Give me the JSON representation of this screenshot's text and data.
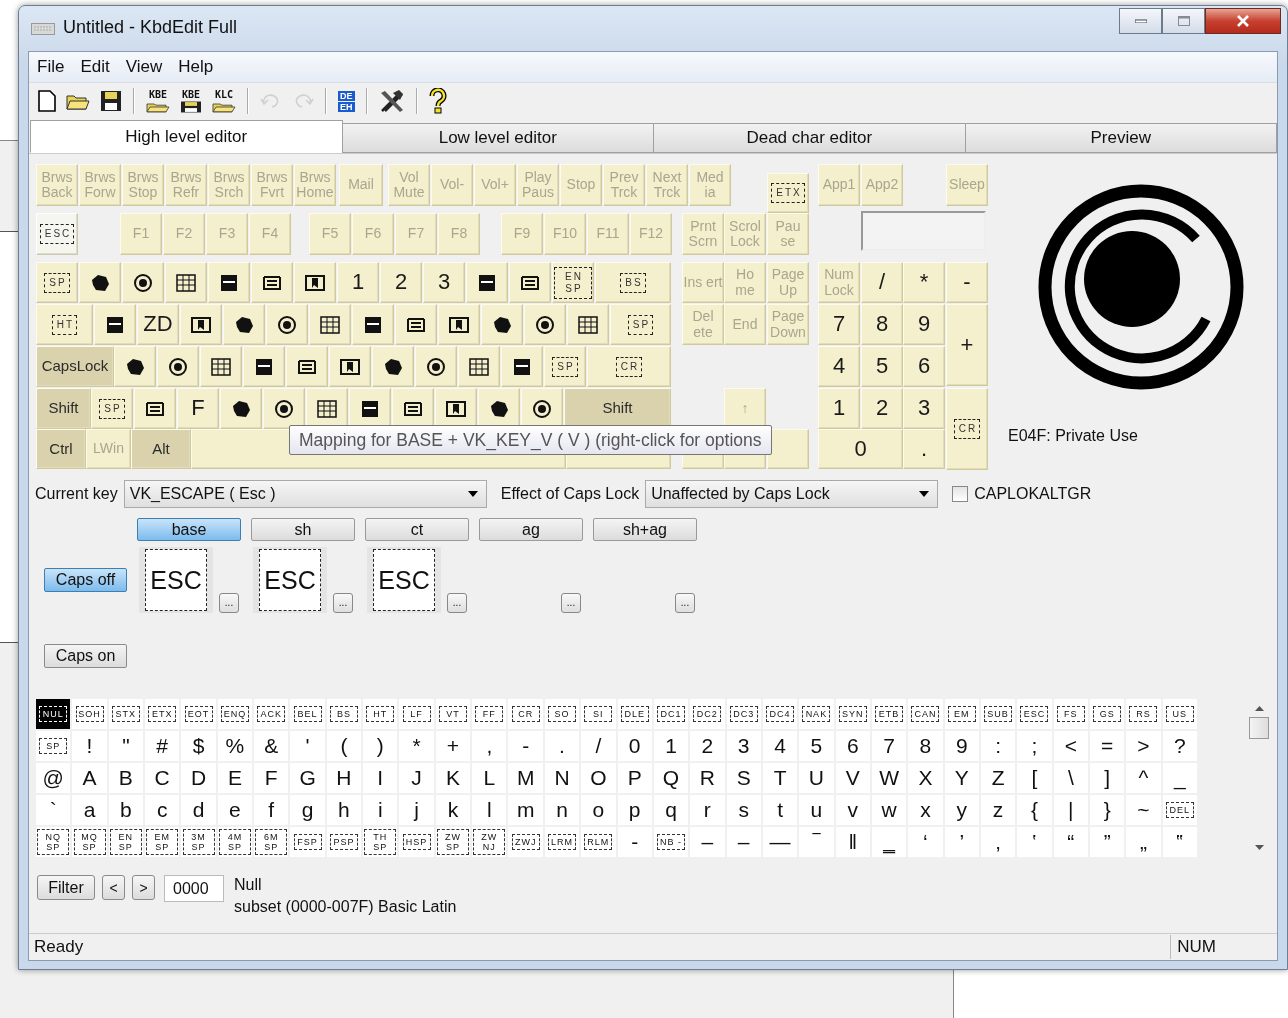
{
  "window": {
    "title": "Untitled - KbdEdit Full"
  },
  "menu": [
    "File",
    "Edit",
    "View",
    "Help"
  ],
  "toolbar": [
    {
      "kind": "new",
      "disabled": false
    },
    {
      "kind": "open",
      "disabled": false
    },
    {
      "kind": "save",
      "disabled": false
    },
    {
      "kind": "separator"
    },
    {
      "kind": "open",
      "label": "KBE",
      "disabled": false
    },
    {
      "kind": "save",
      "label": "KBE",
      "disabled": false
    },
    {
      "kind": "open",
      "label": "KLC",
      "disabled": false
    },
    {
      "kind": "separator"
    },
    {
      "kind": "undo",
      "disabled": true
    },
    {
      "kind": "redo",
      "disabled": true
    },
    {
      "kind": "separator"
    },
    {
      "kind": "table",
      "labels": [
        "DE",
        "EH"
      ],
      "disabled": false
    },
    {
      "kind": "separator"
    },
    {
      "kind": "tools",
      "disabled": false
    },
    {
      "kind": "separator"
    },
    {
      "kind": "help",
      "disabled": false
    }
  ],
  "tabs": [
    {
      "label": "High level editor",
      "selected": true
    },
    {
      "label": "Low level editor",
      "selected": false
    },
    {
      "label": "Dead char editor",
      "selected": false
    },
    {
      "label": "Preview",
      "selected": false
    }
  ],
  "keyboard": {
    "key_rows": [
      {
        "keys": [
          {
            "kind": "function",
            "label": "Brws Back",
            "selected": false
          },
          {
            "kind": "function",
            "label": "Brws Forw",
            "selected": false
          },
          {
            "kind": "function",
            "label": "Brws Stop",
            "selected": false
          },
          {
            "kind": "function",
            "label": "Brws Refr",
            "selected": false
          },
          {
            "kind": "function",
            "label": "Brws Srch",
            "selected": false
          },
          {
            "kind": "function",
            "label": "Brws Fvrt",
            "selected": false
          },
          {
            "kind": "function",
            "label": "Brws Home",
            "selected": false
          },
          {
            "kind": "function",
            "label": "Mail",
            "selected": false
          },
          {
            "kind": "function",
            "label": "Vol Mute",
            "selected": false
          },
          {
            "kind": "function",
            "label": "Vol-",
            "selected": false
          },
          {
            "kind": "function",
            "label": "Vol+",
            "selected": false
          },
          {
            "kind": "function",
            "label": "Play Paus",
            "selected": false
          },
          {
            "kind": "function",
            "label": "Stop",
            "selected": false
          },
          {
            "kind": "function",
            "label": "Prev Trck",
            "selected": false
          },
          {
            "kind": "function",
            "label": "Next Trck",
            "selected": false
          },
          {
            "kind": "function",
            "label": "Med ia",
            "selected": false
          },
          {
            "kind": "control",
            "label": "ETX",
            "selected": false
          },
          {
            "kind": "function",
            "label": "App1",
            "selected": false
          },
          {
            "kind": "function",
            "label": "App2",
            "selected": false
          },
          {
            "kind": "function",
            "label": "Sleep",
            "selected": false
          }
        ]
      },
      {
        "keys": [
          {
            "kind": "control",
            "label": "ESC",
            "selected": true
          },
          {
            "kind": "function",
            "label": "F1",
            "selected": false
          },
          {
            "kind": "function",
            "label": "F2",
            "selected": false
          },
          {
            "kind": "function",
            "label": "F3",
            "selected": false
          },
          {
            "kind": "function",
            "label": "F4",
            "selected": false
          },
          {
            "kind": "function",
            "label": "F5",
            "selected": false
          },
          {
            "kind": "function",
            "label": "F6",
            "selected": false
          },
          {
            "kind": "function",
            "label": "F7",
            "selected": false
          },
          {
            "kind": "function",
            "label": "F8",
            "selected": false
          },
          {
            "kind": "function",
            "label": "F9",
            "selected": false
          },
          {
            "kind": "function",
            "label": "F10",
            "selected": false
          },
          {
            "kind": "function",
            "label": "F11",
            "selected": false
          },
          {
            "kind": "function",
            "label": "F12",
            "selected": false
          },
          {
            "kind": "function",
            "label": "Prnt Scrn",
            "selected": false
          },
          {
            "kind": "function",
            "label": "Scrol Lock",
            "selected": false
          },
          {
            "kind": "function",
            "label": "Pau se",
            "selected": false
          }
        ]
      },
      {
        "keys": [
          {
            "kind": "control",
            "label": "SP",
            "selected": false
          },
          {
            "kind": "glyph",
            "selected": false
          },
          {
            "kind": "glyph",
            "selected": false
          },
          {
            "kind": "glyph",
            "selected": false
          },
          {
            "kind": "glyph",
            "selected": false
          },
          {
            "kind": "glyph",
            "selected": false
          },
          {
            "kind": "glyph",
            "selected": false
          },
          {
            "kind": "char",
            "label": "1",
            "selected": false
          },
          {
            "kind": "char",
            "label": "2",
            "selected": false
          },
          {
            "kind": "char",
            "label": "3",
            "selected": false
          },
          {
            "kind": "glyph",
            "selected": false
          },
          {
            "kind": "glyph",
            "selected": false
          },
          {
            "kind": "control",
            "label": "EN SP",
            "selected": false
          },
          {
            "kind": "control",
            "label": "BS",
            "selected": false
          },
          {
            "kind": "function",
            "label": "Ins ert",
            "selected": false
          },
          {
            "kind": "function",
            "label": "Ho me",
            "selected": false
          },
          {
            "kind": "function",
            "label": "Page Up",
            "selected": false
          },
          {
            "kind": "function",
            "label": "Num Lock",
            "selected": false
          },
          {
            "kind": "char",
            "label": "/",
            "selected": false
          },
          {
            "kind": "char",
            "label": "*",
            "selected": false
          },
          {
            "kind": "char",
            "label": "-",
            "selected": false
          }
        ]
      },
      {
        "keys": [
          {
            "kind": "control",
            "label": "HT",
            "selected": false
          },
          {
            "kind": "glyph",
            "selected": false
          },
          {
            "kind": "char",
            "label": "ZD",
            "selected": false
          },
          {
            "kind": "glyph",
            "selected": false
          },
          {
            "kind": "glyph",
            "selected": false
          },
          {
            "kind": "glyph",
            "selected": false
          },
          {
            "kind": "glyph",
            "selected": false
          },
          {
            "kind": "glyph",
            "selected": false
          },
          {
            "kind": "glyph",
            "selected": false
          },
          {
            "kind": "glyph",
            "selected": false
          },
          {
            "kind": "glyph",
            "selected": false
          },
          {
            "kind": "glyph",
            "selected": false
          },
          {
            "kind": "glyph",
            "selected": false
          },
          {
            "kind": "control",
            "label": "SP",
            "selected": false
          },
          {
            "kind": "function",
            "label": "Del ete",
            "selected": false
          },
          {
            "kind": "function",
            "label": "End",
            "selected": false
          },
          {
            "kind": "function",
            "label": "Page Down",
            "selected": false
          },
          {
            "kind": "char",
            "label": "7",
            "selected": false
          },
          {
            "kind": "char",
            "label": "8",
            "selected": false
          },
          {
            "kind": "char",
            "label": "9",
            "selected": false
          },
          {
            "kind": "char",
            "label": "+",
            "selected": false
          }
        ]
      },
      {
        "keys": [
          {
            "kind": "modifier",
            "label": "CapsLock",
            "selected": false
          },
          {
            "kind": "glyph",
            "selected": false
          },
          {
            "kind": "glyph",
            "selected": false
          },
          {
            "kind": "glyph",
            "selected": false
          },
          {
            "kind": "glyph",
            "selected": false
          },
          {
            "kind": "glyph",
            "selected": false
          },
          {
            "kind": "glyph",
            "selected": false
          },
          {
            "kind": "glyph",
            "selected": false
          },
          {
            "kind": "glyph",
            "selected": false
          },
          {
            "kind": "glyph",
            "selected": false
          },
          {
            "kind": "glyph",
            "selected": false
          },
          {
            "kind": "control",
            "label": "SP",
            "selected": false
          },
          {
            "kind": "control",
            "label": "CR",
            "selected": false
          },
          {
            "kind": "char",
            "label": "4",
            "selected": false
          },
          {
            "kind": "char",
            "label": "5",
            "selected": false
          },
          {
            "kind": "char",
            "label": "6",
            "selected": false
          }
        ]
      },
      {
        "keys": [
          {
            "kind": "modifier",
            "label": "Shift",
            "selected": false
          },
          {
            "kind": "control",
            "label": "SP",
            "selected": false
          },
          {
            "kind": "glyph",
            "selected": false
          },
          {
            "kind": "char",
            "label": "F",
            "selected": false
          },
          {
            "kind": "glyph",
            "selected": false
          },
          {
            "kind": "glyph",
            "selected": false
          },
          {
            "kind": "glyph",
            "selected": false
          },
          {
            "kind": "glyph",
            "selected": false
          },
          {
            "kind": "glyph",
            "selected": false
          },
          {
            "kind": "glyph",
            "selected": false
          },
          {
            "kind": "glyph",
            "selected": false
          },
          {
            "kind": "glyph",
            "selected": false
          },
          {
            "kind": "modifier",
            "label": "Shift",
            "selected": false
          },
          {
            "kind": "function",
            "label": "↑",
            "selected": false
          },
          {
            "kind": "char",
            "label": "1",
            "selected": false
          },
          {
            "kind": "char",
            "label": "2",
            "selected": false
          },
          {
            "kind": "char",
            "label": "3",
            "selected": false
          },
          {
            "kind": "control",
            "label": "CR",
            "selected": false
          }
        ]
      },
      {
        "keys": [
          {
            "kind": "modifier",
            "label": "Ctrl",
            "selected": false
          },
          {
            "kind": "function",
            "label": "LWin",
            "selected": false
          },
          {
            "kind": "modifier",
            "label": "Alt",
            "selected": false
          },
          {
            "kind": "blank",
            "selected": false
          },
          {
            "kind": "blank",
            "selected": false
          },
          {
            "kind": "blank",
            "selected": false
          },
          {
            "kind": "blank",
            "selected": false
          },
          {
            "kind": "blank",
            "selected": false
          },
          {
            "kind": "char",
            "label": "0",
            "selected": false
          },
          {
            "kind": "char",
            "label": ".",
            "selected": false
          }
        ]
      }
    ],
    "tooltip": "Mapping for BASE + VK_KEY_V ( V ) (right-click for options",
    "preview_caption": "E04F: Private Use"
  },
  "current_key": {
    "label": "Current key",
    "value": "VK_ESCAPE ( Esc )"
  },
  "caps_effect": {
    "label": "Effect of Caps Lock",
    "value": "Unaffected by Caps Lock"
  },
  "caplokaltgr": {
    "label": "CAPLOKALTGR",
    "checked": false
  },
  "shift_states": [
    {
      "label": "base",
      "selected": true
    },
    {
      "label": "sh",
      "selected": false
    },
    {
      "label": "ct",
      "selected": false
    },
    {
      "label": "ag",
      "selected": false
    },
    {
      "label": "sh+ag",
      "selected": false
    }
  ],
  "caps_rows": [
    {
      "label": "Caps off",
      "selected": true,
      "mappings": [
        {
          "value": "ESC",
          "more": "..."
        },
        {
          "value": "ESC",
          "more": "..."
        },
        {
          "value": "ESC",
          "more": "..."
        },
        {
          "more": "..."
        },
        {
          "more": "..."
        }
      ]
    },
    {
      "label": "Caps on",
      "selected": false,
      "mappings": []
    }
  ],
  "charmap": {
    "rows": [
      [
        {
          "char": "NUL",
          "kind": "control",
          "selected": true
        },
        {
          "char": "SOH",
          "kind": "control",
          "selected": false
        },
        {
          "char": "STX",
          "kind": "control",
          "selected": false
        },
        {
          "char": "ETX",
          "kind": "control",
          "selected": false
        },
        {
          "char": "EOT",
          "kind": "control",
          "selected": false
        },
        {
          "char": "ENQ",
          "kind": "control",
          "selected": false
        },
        {
          "char": "ACK",
          "kind": "control",
          "selected": false
        },
        {
          "char": "BEL",
          "kind": "control",
          "selected": false
        },
        {
          "char": "BS",
          "kind": "control",
          "selected": false
        },
        {
          "char": "HT",
          "kind": "control",
          "selected": false
        },
        {
          "char": "LF",
          "kind": "control",
          "selected": false
        },
        {
          "char": "VT",
          "kind": "control",
          "selected": false
        },
        {
          "char": "FF",
          "kind": "control",
          "selected": false
        },
        {
          "char": "CR",
          "kind": "control",
          "selected": false
        },
        {
          "char": "SO",
          "kind": "control",
          "selected": false
        },
        {
          "char": "SI",
          "kind": "control",
          "selected": false
        },
        {
          "char": "DLE",
          "kind": "control",
          "selected": false
        },
        {
          "char": "DC1",
          "kind": "control",
          "selected": false
        },
        {
          "char": "DC2",
          "kind": "control",
          "selected": false
        },
        {
          "char": "DC3",
          "kind": "control",
          "selected": false
        },
        {
          "char": "DC4",
          "kind": "control",
          "selected": false
        },
        {
          "char": "NAK",
          "kind": "control",
          "selected": false
        },
        {
          "char": "SYN",
          "kind": "control",
          "selected": false
        },
        {
          "char": "ETB",
          "kind": "control",
          "selected": false
        },
        {
          "char": "CAN",
          "kind": "control",
          "selected": false
        },
        {
          "char": "EM",
          "kind": "control",
          "selected": false
        },
        {
          "char": "SUB",
          "kind": "control",
          "selected": false
        },
        {
          "char": "ESC",
          "kind": "control",
          "selected": false
        },
        {
          "char": "FS",
          "kind": "control",
          "selected": false
        },
        {
          "char": "GS",
          "kind": "control",
          "selected": false
        },
        {
          "char": "RS",
          "kind": "control",
          "selected": false
        },
        {
          "char": "US",
          "kind": "control",
          "selected": false
        }
      ],
      [
        {
          "char": "SP",
          "kind": "control",
          "selected": false
        },
        {
          "char": "!",
          "kind": "char",
          "selected": false
        },
        {
          "char": "\"",
          "kind": "char",
          "selected": false
        },
        {
          "char": "#",
          "kind": "char",
          "selected": false
        },
        {
          "char": "$",
          "kind": "char",
          "selected": false
        },
        {
          "char": "%",
          "kind": "char",
          "selected": false
        },
        {
          "char": "&",
          "kind": "char",
          "selected": false
        },
        {
          "char": "'",
          "kind": "char",
          "selected": false
        },
        {
          "char": "(",
          "kind": "char",
          "selected": false
        },
        {
          "char": ")",
          "kind": "char",
          "selected": false
        },
        {
          "char": "*",
          "kind": "char",
          "selected": false
        },
        {
          "char": "+",
          "kind": "char",
          "selected": false
        },
        {
          "char": ",",
          "kind": "char",
          "selected": false
        },
        {
          "char": "-",
          "kind": "char",
          "selected": false
        },
        {
          "char": ".",
          "kind": "char",
          "selected": false
        },
        {
          "char": "/",
          "kind": "char",
          "selected": false
        },
        {
          "char": "0",
          "kind": "char",
          "selected": false
        },
        {
          "char": "1",
          "kind": "char",
          "selected": false
        },
        {
          "char": "2",
          "kind": "char",
          "selected": false
        },
        {
          "char": "3",
          "kind": "char",
          "selected": false
        },
        {
          "char": "4",
          "kind": "char",
          "selected": false
        },
        {
          "char": "5",
          "kind": "char",
          "selected": false
        },
        {
          "char": "6",
          "kind": "char",
          "selected": false
        },
        {
          "char": "7",
          "kind": "char",
          "selected": false
        },
        {
          "char": "8",
          "kind": "char",
          "selected": false
        },
        {
          "char": "9",
          "kind": "char",
          "selected": false
        },
        {
          "char": ":",
          "kind": "char",
          "selected": false
        },
        {
          "char": ";",
          "kind": "char",
          "selected": false
        },
        {
          "char": "<",
          "kind": "char",
          "selected": false
        },
        {
          "char": "=",
          "kind": "char",
          "selected": false
        },
        {
          "char": ">",
          "kind": "char",
          "selected": false
        },
        {
          "char": "?",
          "kind": "char",
          "selected": false
        }
      ],
      [
        {
          "char": "@",
          "kind": "char",
          "selected": false
        },
        {
          "char": "A",
          "kind": "char",
          "selected": false
        },
        {
          "char": "B",
          "kind": "char",
          "selected": false
        },
        {
          "char": "C",
          "kind": "char",
          "selected": false
        },
        {
          "char": "D",
          "kind": "char",
          "selected": false
        },
        {
          "char": "E",
          "kind": "char",
          "selected": false
        },
        {
          "char": "F",
          "kind": "char",
          "selected": false
        },
        {
          "char": "G",
          "kind": "char",
          "selected": false
        },
        {
          "char": "H",
          "kind": "char",
          "selected": false
        },
        {
          "char": "I",
          "kind": "char",
          "selected": false
        },
        {
          "char": "J",
          "kind": "char",
          "selected": false
        },
        {
          "char": "K",
          "kind": "char",
          "selected": false
        },
        {
          "char": "L",
          "kind": "char",
          "selected": false
        },
        {
          "char": "M",
          "kind": "char",
          "selected": false
        },
        {
          "char": "N",
          "kind": "char",
          "selected": false
        },
        {
          "char": "O",
          "kind": "char",
          "selected": false
        },
        {
          "char": "P",
          "kind": "char",
          "selected": false
        },
        {
          "char": "Q",
          "kind": "char",
          "selected": false
        },
        {
          "char": "R",
          "kind": "char",
          "selected": false
        },
        {
          "char": "S",
          "kind": "char",
          "selected": false
        },
        {
          "char": "T",
          "kind": "char",
          "selected": false
        },
        {
          "char": "U",
          "kind": "char",
          "selected": false
        },
        {
          "char": "V",
          "kind": "char",
          "selected": false
        },
        {
          "char": "W",
          "kind": "char",
          "selected": false
        },
        {
          "char": "X",
          "kind": "char",
          "selected": false
        },
        {
          "char": "Y",
          "kind": "char",
          "selected": false
        },
        {
          "char": "Z",
          "kind": "char",
          "selected": false
        },
        {
          "char": "[",
          "kind": "char",
          "selected": false
        },
        {
          "char": "\\",
          "kind": "char",
          "selected": false
        },
        {
          "char": "]",
          "kind": "char",
          "selected": false
        },
        {
          "char": "^",
          "kind": "char",
          "selected": false
        },
        {
          "char": "_",
          "kind": "char",
          "selected": false
        }
      ],
      [
        {
          "char": "`",
          "kind": "char",
          "selected": false
        },
        {
          "char": "a",
          "kind": "char",
          "selected": false
        },
        {
          "char": "b",
          "kind": "char",
          "selected": false
        },
        {
          "char": "c",
          "kind": "char",
          "selected": false
        },
        {
          "char": "d",
          "kind": "char",
          "selected": false
        },
        {
          "char": "e",
          "kind": "char",
          "selected": false
        },
        {
          "char": "f",
          "kind": "char",
          "selected": false
        },
        {
          "char": "g",
          "kind": "char",
          "selected": false
        },
        {
          "char": "h",
          "kind": "char",
          "selected": false
        },
        {
          "char": "i",
          "kind": "char",
          "selected": false
        },
        {
          "char": "j",
          "kind": "char",
          "selected": false
        },
        {
          "char": "k",
          "kind": "char",
          "selected": false
        },
        {
          "char": "l",
          "kind": "char",
          "selected": false
        },
        {
          "char": "m",
          "kind": "char",
          "selected": false
        },
        {
          "char": "n",
          "kind": "char",
          "selected": false
        },
        {
          "char": "o",
          "kind": "char",
          "selected": false
        },
        {
          "char": "p",
          "kind": "char",
          "selected": false
        },
        {
          "char": "q",
          "kind": "char",
          "selected": false
        },
        {
          "char": "r",
          "kind": "char",
          "selected": false
        },
        {
          "char": "s",
          "kind": "char",
          "selected": false
        },
        {
          "char": "t",
          "kind": "char",
          "selected": false
        },
        {
          "char": "u",
          "kind": "char",
          "selected": false
        },
        {
          "char": "v",
          "kind": "char",
          "selected": false
        },
        {
          "char": "w",
          "kind": "char",
          "selected": false
        },
        {
          "char": "x",
          "kind": "char",
          "selected": false
        },
        {
          "char": "y",
          "kind": "char",
          "selected": false
        },
        {
          "char": "z",
          "kind": "char",
          "selected": false
        },
        {
          "char": "{",
          "kind": "char",
          "selected": false
        },
        {
          "char": "|",
          "kind": "char",
          "selected": false
        },
        {
          "char": "}",
          "kind": "char",
          "selected": false
        },
        {
          "char": "~",
          "kind": "char",
          "selected": false
        },
        {
          "char": "DEL",
          "kind": "control",
          "selected": false
        }
      ],
      [
        {
          "char": "NQ SP",
          "kind": "control",
          "selected": false
        },
        {
          "char": "MQ SP",
          "kind": "control",
          "selected": false
        },
        {
          "char": "EN SP",
          "kind": "control",
          "selected": false
        },
        {
          "char": "EM SP",
          "kind": "control",
          "selected": false
        },
        {
          "char": "3M SP",
          "kind": "control",
          "selected": false
        },
        {
          "char": "4M SP",
          "kind": "control",
          "selected": false
        },
        {
          "char": "6M SP",
          "kind": "control",
          "selected": false
        },
        {
          "char": "FSP",
          "kind": "control",
          "selected": false
        },
        {
          "char": "PSP",
          "kind": "control",
          "selected": false
        },
        {
          "char": "TH SP",
          "kind": "control",
          "selected": false
        },
        {
          "char": "HSP",
          "kind": "control",
          "selected": false
        },
        {
          "char": "ZW SP",
          "kind": "control",
          "selected": false
        },
        {
          "char": "ZW NJ",
          "kind": "control",
          "selected": false
        },
        {
          "char": "ZWJ",
          "kind": "control",
          "selected": false
        },
        {
          "char": "LRM",
          "kind": "control",
          "selected": false
        },
        {
          "char": "RLM",
          "kind": "control",
          "selected": false
        },
        {
          "char": "‐",
          "kind": "char",
          "selected": false
        },
        {
          "char": "NB -",
          "kind": "control",
          "selected": false
        },
        {
          "char": "‒",
          "kind": "char",
          "selected": false
        },
        {
          "char": "–",
          "kind": "char",
          "selected": false
        },
        {
          "char": "—",
          "kind": "char",
          "selected": false
        },
        {
          "char": "‾",
          "kind": "char",
          "selected": false
        },
        {
          "char": "‖",
          "kind": "char",
          "selected": false
        },
        {
          "char": "‗",
          "kind": "char",
          "selected": false
        },
        {
          "char": "‘",
          "kind": "char",
          "selected": false
        },
        {
          "char": "’",
          "kind": "char",
          "selected": false
        },
        {
          "char": "‚",
          "kind": "char",
          "selected": false
        },
        {
          "char": "‛",
          "kind": "char",
          "selected": false
        },
        {
          "char": "“",
          "kind": "char",
          "selected": false
        },
        {
          "char": "”",
          "kind": "char",
          "selected": false
        },
        {
          "char": "„",
          "kind": "char",
          "selected": false
        },
        {
          "char": "‟",
          "kind": "char",
          "selected": false
        }
      ]
    ]
  },
  "filter": {
    "button": "Filter",
    "prev": "<",
    "next": ">",
    "code": "0000",
    "name": "Null",
    "subset": "subset (0000-007F) Basic Latin"
  },
  "status_bar": {
    "message": "Ready",
    "num": "NUM"
  }
}
